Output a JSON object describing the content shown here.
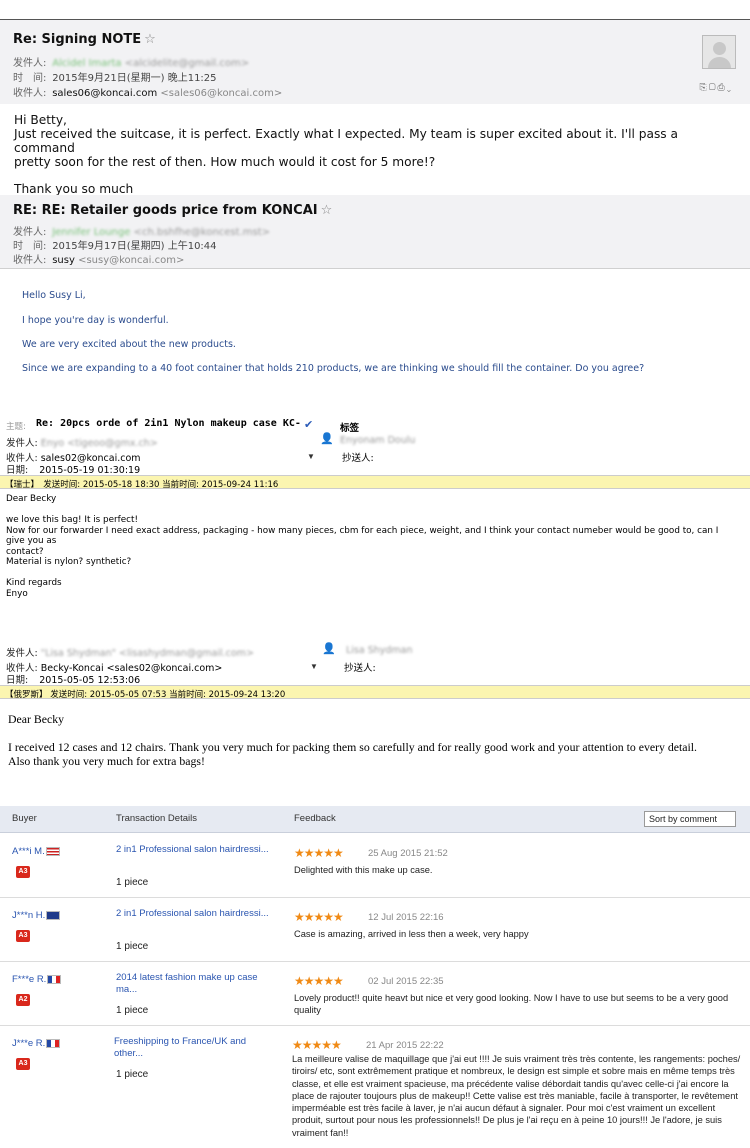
{
  "email1": {
    "subject": "Re: Signing NOTE",
    "sender_label": "发件人:",
    "sender_name": "Alcidel Imarta",
    "sender_email": "<alcidelite@gmail.com>",
    "time_label": "时　间:",
    "time_value": "2015年9月21日(星期一) 晚上11:25",
    "recipient_label": "收件人:",
    "recipient": "sales06@koncai.com",
    "recipient_email": "<sales06@koncai.com>",
    "body": [
      "Hi Betty,",
      "Just received the suitcase, it is perfect. Exactly what I expected. My team is super excited about it. I'll pass a command",
      "pretty soon for the rest of then. How much would it cost for 5 more!?",
      "",
      "Thank you so much"
    ]
  },
  "email2": {
    "subject": "RE: RE: Retailer goods price from KONCAI",
    "sender_label": "发件人:",
    "sender_name": "Jennifer Lounge",
    "sender_email": "<ch.bshfhe@koncest.mst>",
    "time_label": "时　间:",
    "time_value": "2015年9月17日(星期四) 上午10:44",
    "recipient_label": "收件人:",
    "recipient": "susy",
    "recipient_email": "<susy@koncai.com>",
    "body": [
      "Hello Susy Li,",
      "I hope you're day is wonderful.",
      "We are very excited about the new products.",
      "Since we are expanding to a 40 foot container that holds 210 products, we are thinking we should fill the container. Do you agree?"
    ]
  },
  "email3": {
    "subject_label": "主题:",
    "subject": "Re: 20pcs orde of 2in1 Nylon makeup case KC-",
    "tag_label": "标签",
    "sender_label": "发件人:",
    "sender": "Enyo <tigeoo@gmx.ch>",
    "sender_display": "Enyonam Doulu",
    "recipient_label": "收件人:",
    "recipient": "sales02@koncai.com",
    "cc_label": "抄送人:",
    "date_label": "日期:",
    "date": "2015-05-19 01:30:19",
    "bar": "【瑞士】　发送时间: 2015-05-18 18:30  当前时间: 2015-09-24 11:16",
    "body": [
      "Dear Becky",
      "",
      "we love this bag! It is perfect!",
      "Now for our forwarder I need exact address, packaging - how many pieces, cbm for each piece, weight, and I think your contact numeber would be good to, can I give you as",
      "contact?",
      "Material is nylon? synthetic?",
      "",
      "Kind regards",
      "Enyo"
    ]
  },
  "email4": {
    "sender_label": "发件人:",
    "sender": "\"Lisa Shydman\" <lisashydman@gmail.com>",
    "sender_display": "Lisa Shydman",
    "recipient_label": "收件人:",
    "recipient": "Becky-Koncai <sales02@koncai.com>",
    "cc_label": "抄送人:",
    "date_label": "日期:",
    "date": "2015-05-05 12:53:06",
    "bar": "【俄罗斯】 发送时间: 2015-05-05 07:53  当前时间: 2015-09-24 13:20",
    "body": [
      "Dear Becky",
      "",
      "I received 12 cases and 12 chairs. Thank you very much for packing them so carefully and for really good work and your attention to every detail.",
      "Also thank you very much for extra bags!"
    ]
  },
  "feedback": {
    "headers": {
      "buyer": "Buyer",
      "details": "Transaction Details",
      "feedback": "Feedback"
    },
    "sort_label": "Sort by comment",
    "rows": [
      {
        "buyer": "A***i M.",
        "flag": "us",
        "badge": "A3",
        "product": "2 in1 Professional salon hairdressi...",
        "qty": "1 piece",
        "stars": 5,
        "date": "25 Aug 2015 21:52",
        "comment": "Delighted with this make up case."
      },
      {
        "buyer": "J***n H.",
        "flag": "au",
        "badge": "A3",
        "product": "2 in1 Professional salon hairdressi...",
        "qty": "1 piece",
        "stars": 5,
        "date": "12 Jul 2015 22:16",
        "comment": "Case is amazing, arrived in less then a week, very happy"
      },
      {
        "buyer": "F***e R.",
        "flag": "fr",
        "badge": "A2",
        "product": "2014 latest fashion make up case ma...",
        "qty": "1 piece",
        "stars": 5,
        "date": "02 Jul 2015 22:35",
        "comment": "Lovely product!! quite heavt but nice et very good looking. Now I have to use but seems to be a very good quality"
      },
      {
        "buyer": "J***e R.",
        "flag": "fr",
        "badge": "A3",
        "product": "Freeshipping to France/UK and other...",
        "qty": "1 piece",
        "stars": 5,
        "date": "21 Apr 2015 22:22",
        "comment": "La meilleure valise de maquillage que j'ai eut !!!! Je suis vraiment très très contente, les rangements: poches/ tiroirs/ etc, sont extrêmement pratique et nombreux, le design est simple et sobre mais en même temps très classe, et elle est vraiment spacieuse, ma précédente valise débordait tandis qu'avec celle-ci j'ai encore la place de rajouter toujours plus de makeup!! Cette valise est très maniable, facile à transporter, le revêtement imperméable est très facile à laver, je n'ai aucun défaut à signaler. Pour moi c'est vraiment un excellent produit, surtout pour nous les professionnels!! De plus je l'ai reçu en à peine 10 jours!!! Je l'adore, je suis vraiment fan!!"
      }
    ]
  }
}
